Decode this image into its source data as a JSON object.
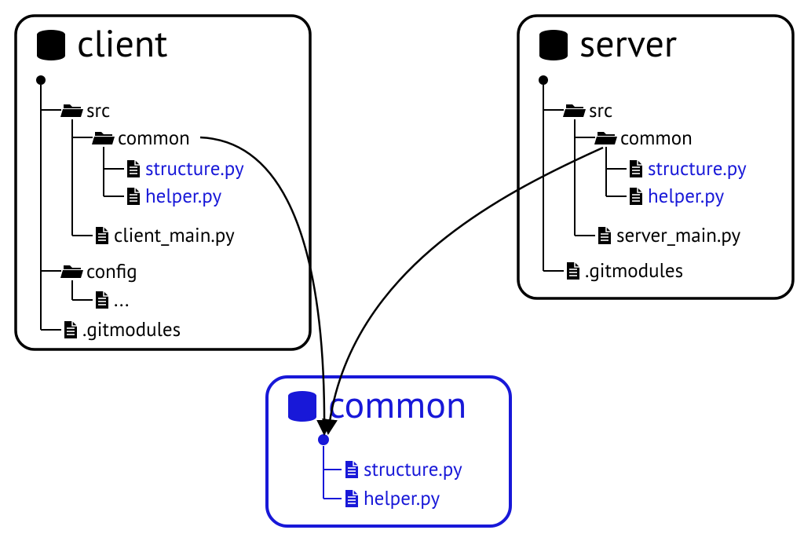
{
  "colors": {
    "normal": "#000000",
    "link": "#1818d8"
  },
  "repos": {
    "client": {
      "title": "client",
      "tree": {
        "src": "src",
        "common": "common",
        "structure": "structure.py",
        "helper": "helper.py",
        "main": "client_main.py",
        "config": "config",
        "config_more": "...",
        "gitmodules": ".gitmodules"
      }
    },
    "server": {
      "title": "server",
      "tree": {
        "src": "src",
        "common": "common",
        "structure": "structure.py",
        "helper": "helper.py",
        "main": "server_main.py",
        "gitmodules": ".gitmodules"
      }
    },
    "common": {
      "title": "common",
      "tree": {
        "structure": "structure.py",
        "helper": "helper.py"
      }
    }
  }
}
